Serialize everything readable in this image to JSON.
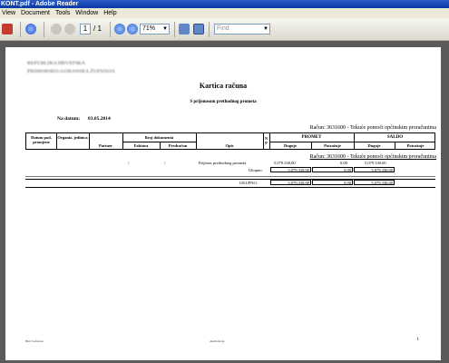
{
  "window": {
    "title": "KONT.pdf - Adobe Reader"
  },
  "menu": [
    "View",
    "Document",
    "Tools",
    "Window",
    "Help"
  ],
  "toolbar": {
    "page_current": "1",
    "page_total": "/ 1",
    "zoom": "71%",
    "find_placeholder": "Find"
  },
  "doc": {
    "title": "Kartica računa",
    "subtitle": "S prijenosom prethodnog prometa",
    "blurred_org": [
      "REPUBLIKA HRVATSKA",
      "PRIMORSKO-GORANSKA ŽUPANIJA"
    ],
    "date_label": "Na datum:",
    "date_value": "03.05.2014",
    "account_header": "Račun: 3631600 - Tekuće pomoći općinskim proračunima",
    "account_line": "Račun: 3631600 - Tekuće pomoći općinskim proračunima",
    "columns": {
      "datum": "Datum pod. promjene",
      "org": "Organiz. jedinica",
      "partner": "Partner",
      "broj": "Broj dokumenta",
      "faktura": "Faktura",
      "predracun": "Predračun",
      "opis": "Opis",
      "np": "N P",
      "promet": "PROMET",
      "saldo": "SALDO",
      "duguje": "Duguje",
      "potrazuje": "Potražuje",
      "duguje2": "Duguje",
      "potrazuje2": "Potražuje"
    },
    "rows": {
      "prijenos_label": "Prijenos prethodnog prometa",
      "prijenos_duguje": "5.079.330,00",
      "prijenos_potrazuje": "0,00",
      "prijenos_saldo": "5.079.330,00",
      "ukupno_label": "Ukupno:",
      "ukupno_duguje": "5.079.330,00",
      "ukupno_potrazuje": "0,00",
      "ukupno_saldo": "5.079.330,00",
      "total_label": "UKUPNO:",
      "total_duguje": "5.079.330,00",
      "total_potrazuje": "0,00",
      "total_saldo": "5.079.330,00",
      "slashes": [
        "/",
        "/"
      ]
    },
    "footer": {
      "left": "Bird Software",
      "center": "dardlom.rpt",
      "page": "1"
    }
  }
}
